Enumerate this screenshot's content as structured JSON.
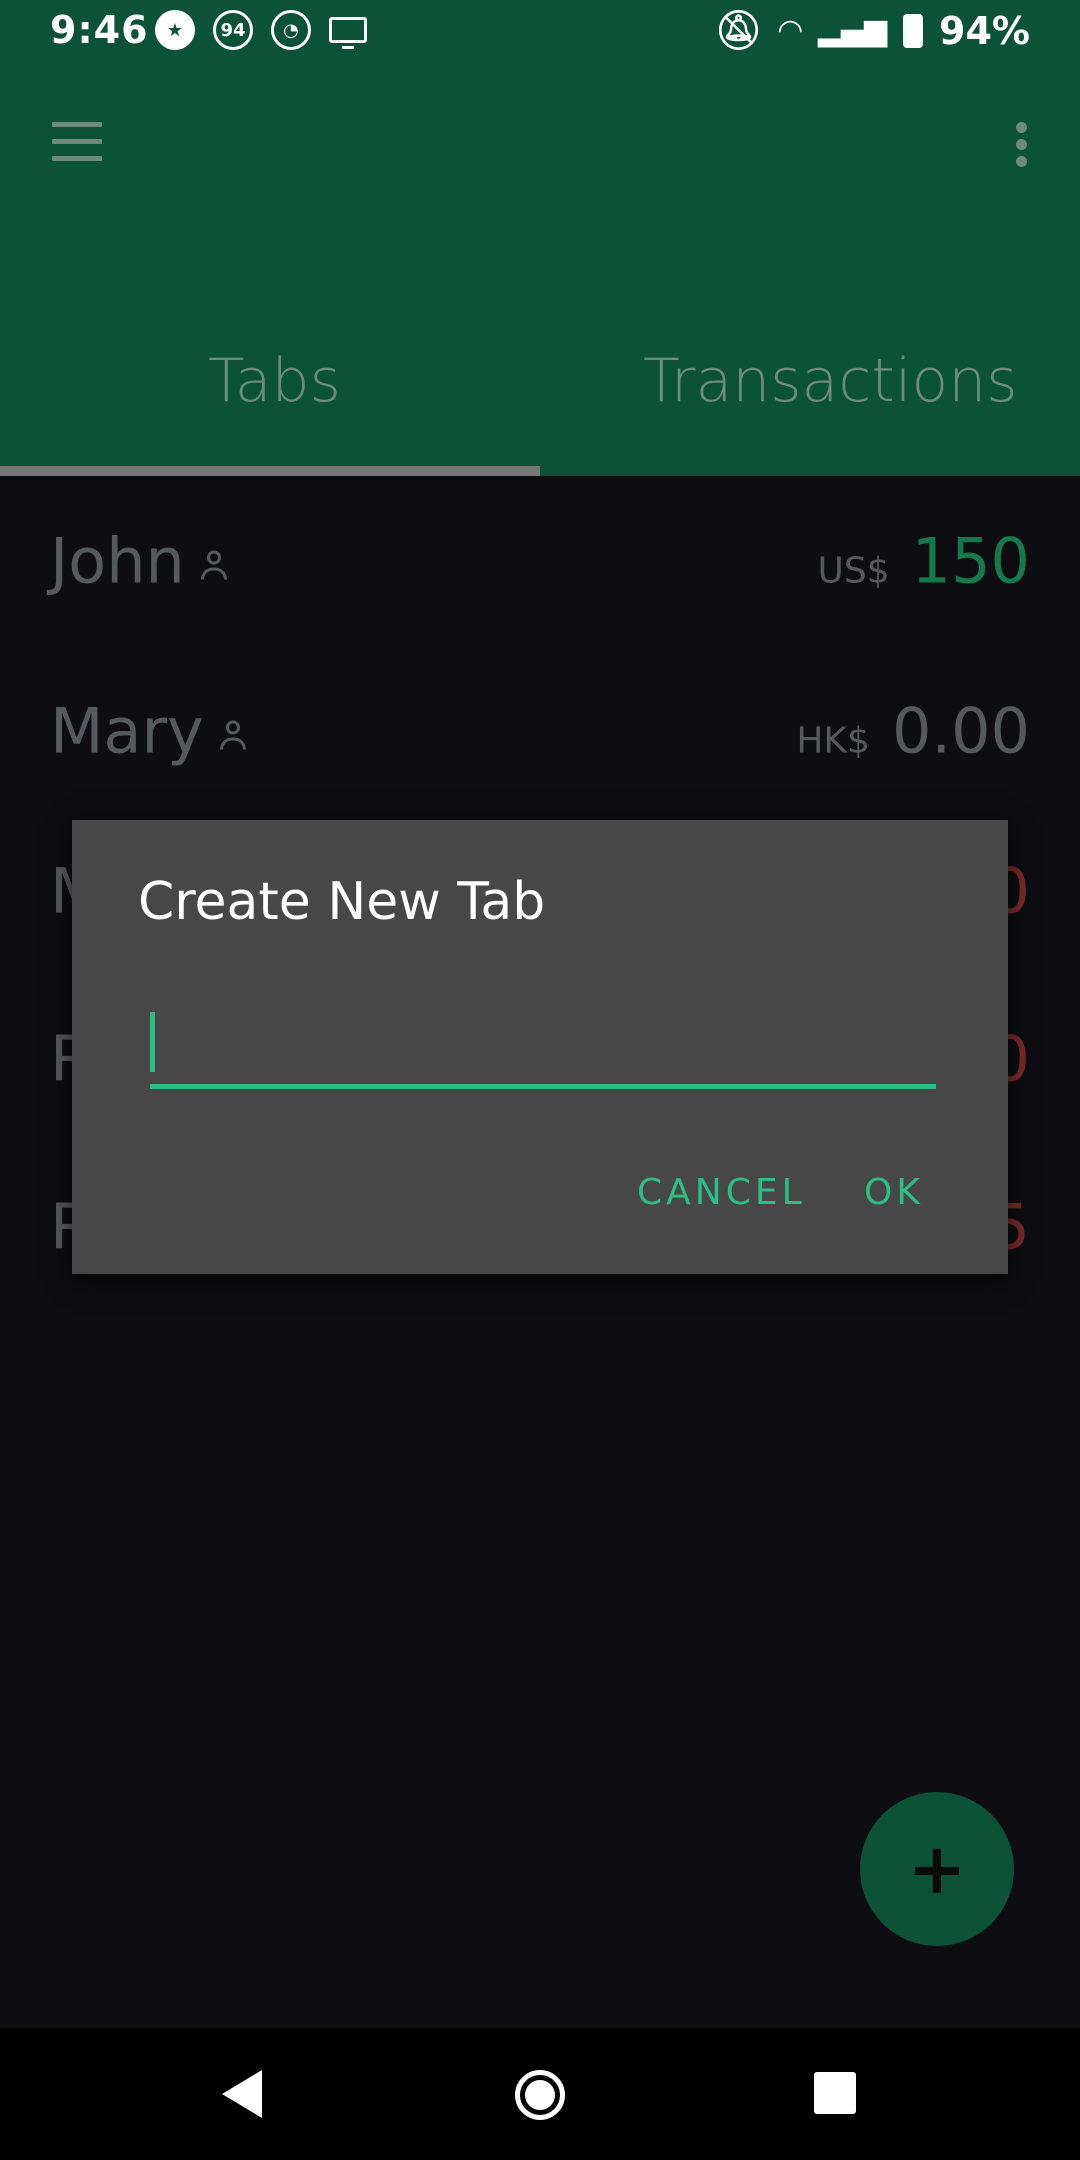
{
  "status_bar": {
    "time": "9:46",
    "badge_94": "94",
    "battery": "94%",
    "icons": [
      "starbucks-icon",
      "route-94-icon",
      "arc-icon",
      "monitor-icon",
      "bell-off-icon",
      "wifi-icon",
      "signal-icon",
      "battery-charging-icon"
    ]
  },
  "app_bar": {
    "tabs": [
      {
        "label": "Tabs",
        "selected": true
      },
      {
        "label": "Transactions",
        "selected": false
      }
    ]
  },
  "list": {
    "rows": [
      {
        "name": "John",
        "currency": "US$",
        "amount": "150",
        "color": "#137a4e"
      },
      {
        "name": "Mary",
        "currency": "HK$",
        "amount": "0.00",
        "color": "#55585c"
      },
      {
        "name": "M",
        "currency": "",
        "amount": "0",
        "color": "#7a2a2a"
      },
      {
        "name": "R",
        "currency": "",
        "amount": "0",
        "color": "#7a2a2a"
      },
      {
        "name": "R",
        "currency": "",
        "amount": "5",
        "color": "#7a2a2a"
      }
    ]
  },
  "dialog": {
    "title": "Create New Tab",
    "input_value": "",
    "cancel_label": "CANCEL",
    "ok_label": "OK"
  },
  "fab": {
    "label": "+"
  },
  "colors": {
    "primary": "#0b5236",
    "accent": "#2bbf86",
    "background": "#0e0e12",
    "dialog": "#474747"
  }
}
